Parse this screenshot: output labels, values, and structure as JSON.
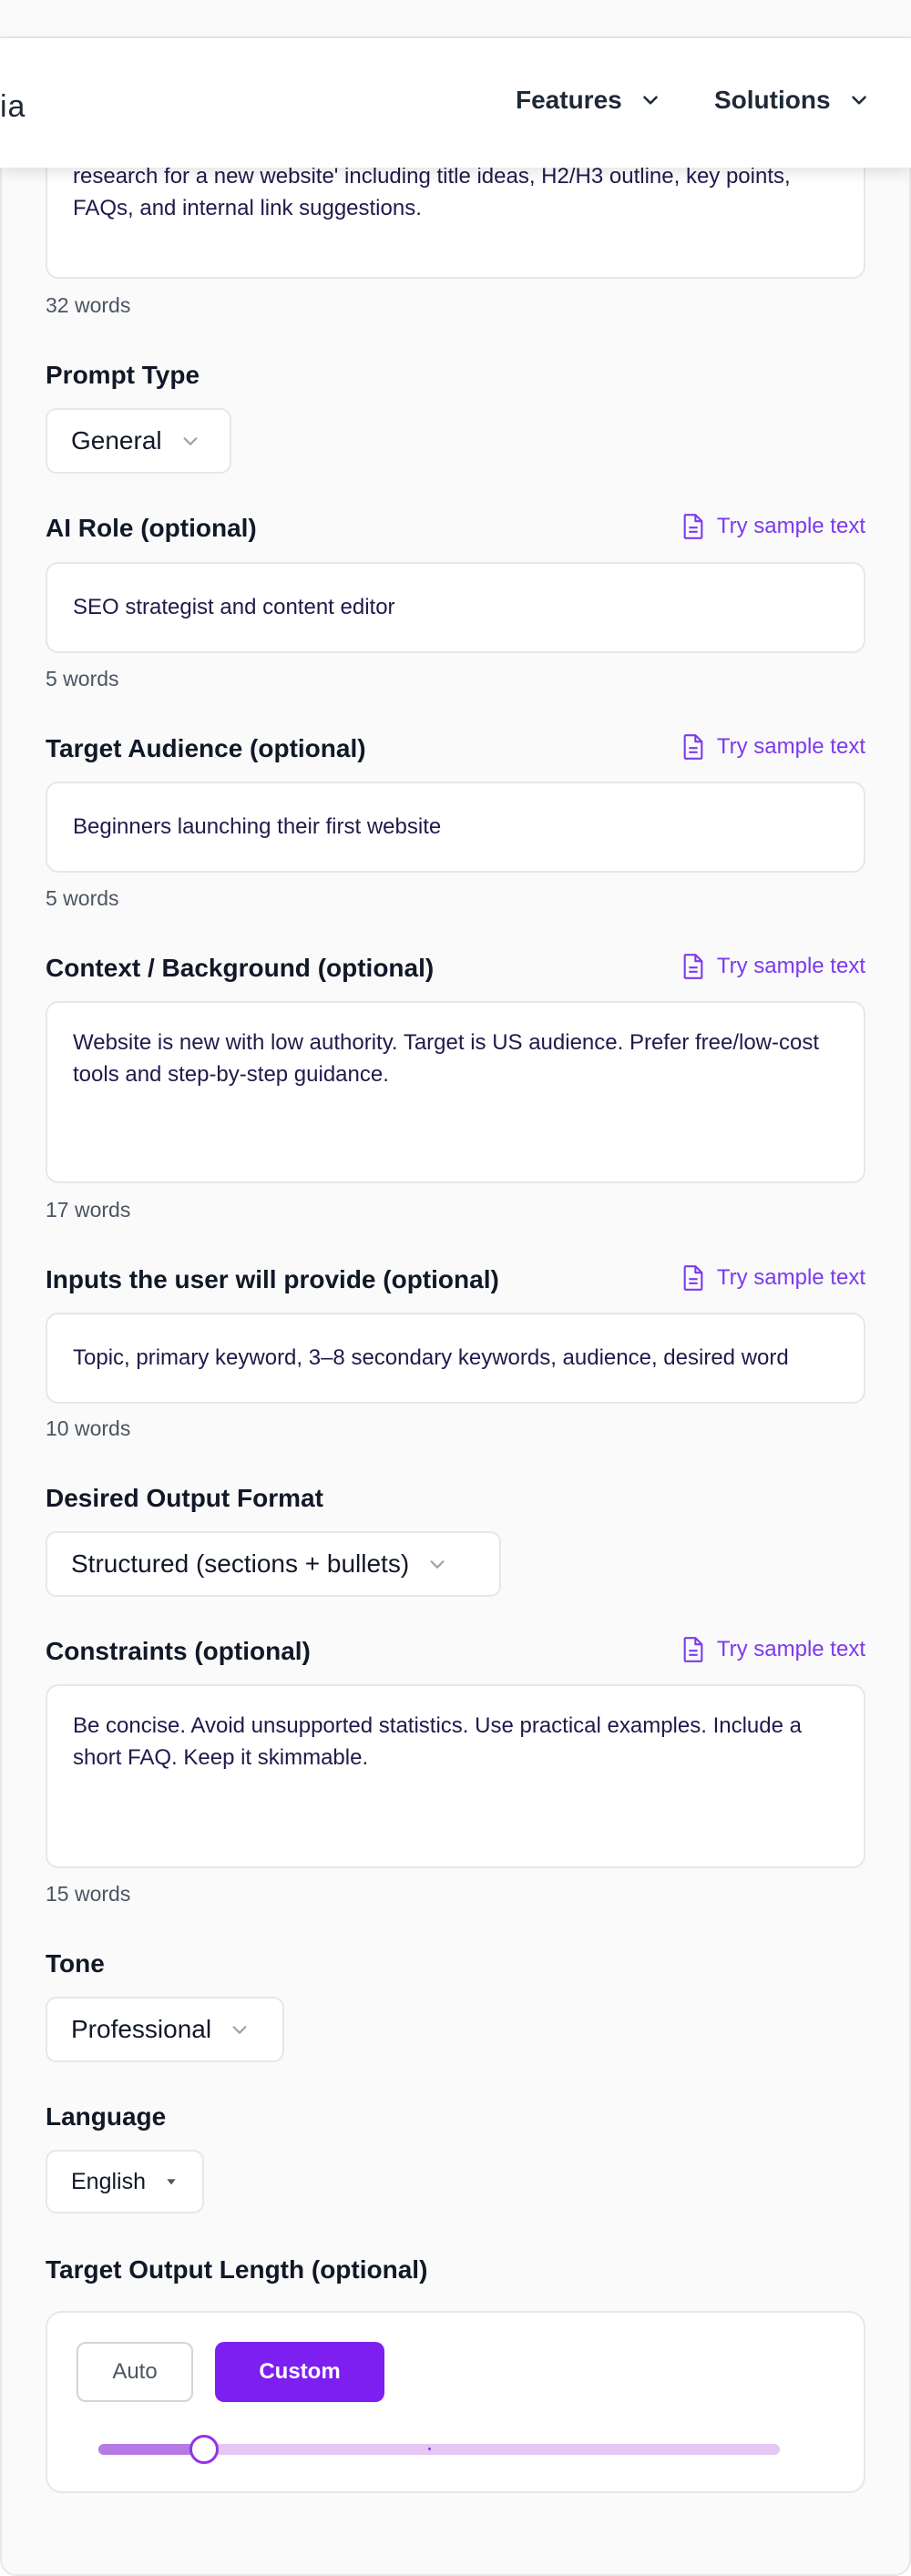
{
  "header": {
    "logo_fragment": "ia",
    "nav": [
      {
        "label": "Features"
      },
      {
        "label": "Solutions"
      }
    ]
  },
  "task": {
    "value_partial": "research for a new website' including title ideas, H2/H3 outline, key points, FAQs, and internal link suggestions.",
    "word_count": "32 words"
  },
  "prompt_type": {
    "label": "Prompt Type",
    "selected": "General"
  },
  "sample_label": "Try sample text",
  "ai_role": {
    "label": "AI Role (optional)",
    "value": "SEO strategist and content editor",
    "word_count": "5 words"
  },
  "target_audience": {
    "label": "Target Audience (optional)",
    "value": "Beginners launching their first website",
    "word_count": "5 words"
  },
  "context": {
    "label": "Context / Background (optional)",
    "value": "Website is new with low authority. Target is US audience. Prefer free/low-cost tools and step-by-step guidance.",
    "word_count": "17 words"
  },
  "inputs": {
    "label": "Inputs the user will provide (optional)",
    "value": "Topic, primary keyword, 3–8 secondary keywords, audience, desired word",
    "word_count": "10 words"
  },
  "output_format": {
    "label": "Desired Output Format",
    "selected": "Structured (sections + bullets)"
  },
  "constraints": {
    "label": "Constraints (optional)",
    "value": "Be concise. Avoid unsupported statistics. Use practical examples. Include a short FAQ. Keep it skimmable.",
    "word_count": "15 words"
  },
  "tone": {
    "label": "Tone",
    "selected": "Professional"
  },
  "language": {
    "label": "Language",
    "selected": "English"
  },
  "output_length": {
    "label": "Target Output Length (optional)",
    "auto_label": "Auto",
    "custom_label": "Custom",
    "mode": "Custom",
    "slider_fraction": 0.155
  },
  "colors": {
    "accent": "#7c3aed",
    "button_primary": "#7c1ff0",
    "slider_track": "#e6c6f3",
    "slider_fill": "#b57ae6"
  }
}
